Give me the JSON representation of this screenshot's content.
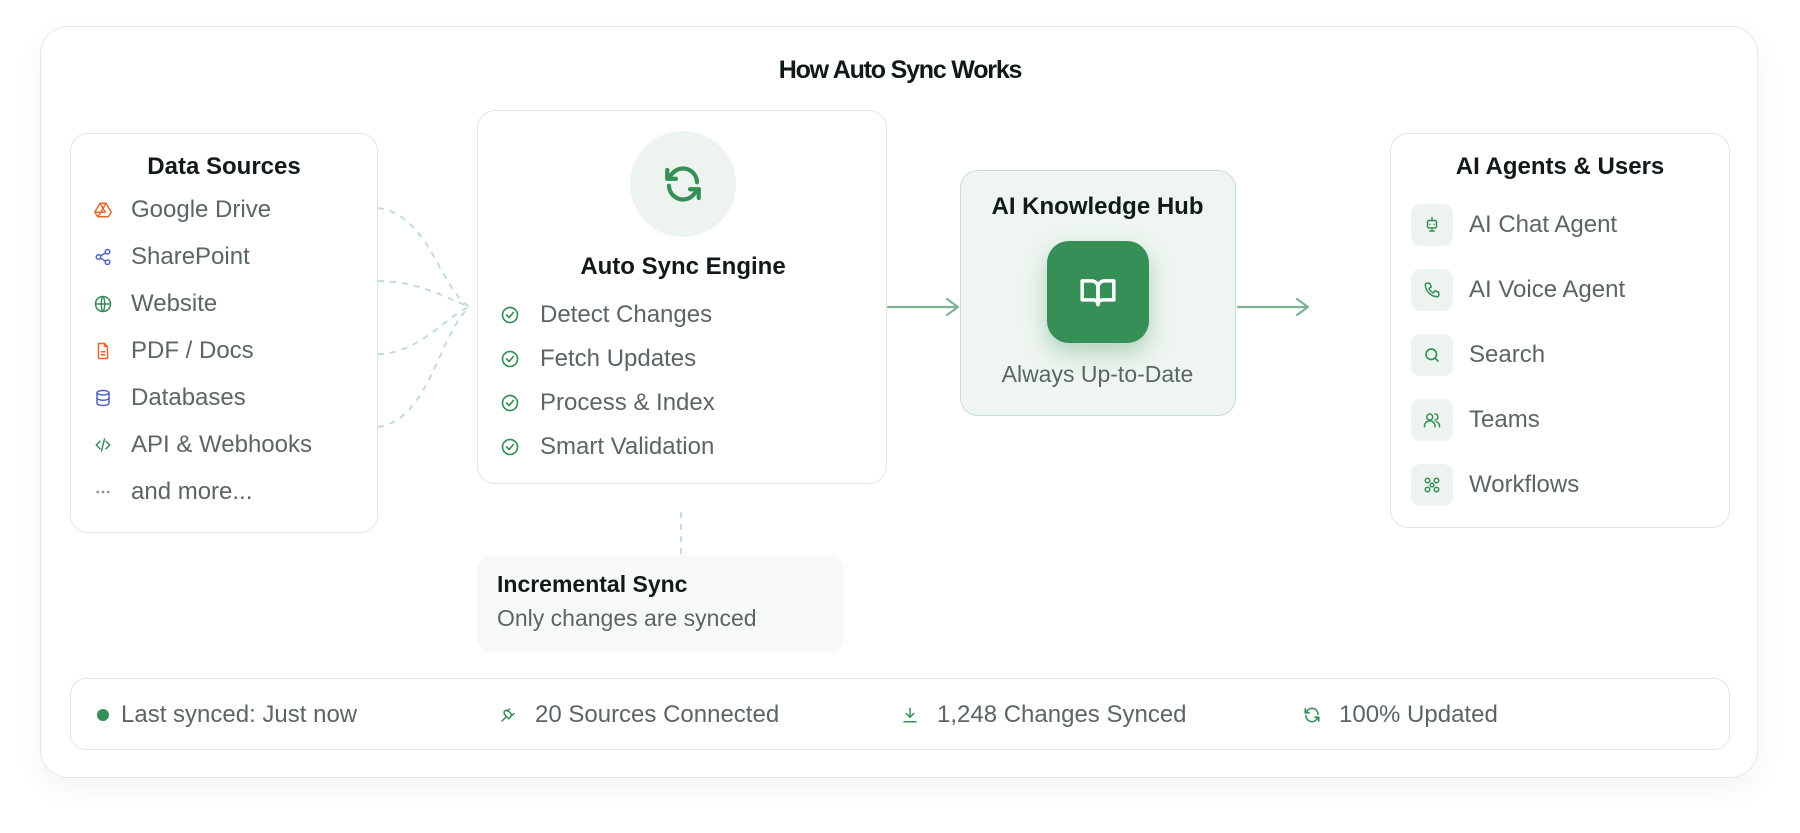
{
  "title": "How Auto Sync Works",
  "colors": {
    "accent": "#368f57",
    "accent_light": "#edf4ef",
    "text": "#5b6661",
    "heading": "#111a15"
  },
  "sources": {
    "title": "Data Sources",
    "items": [
      {
        "label": "Google Drive",
        "icon": "google-drive-icon",
        "color": "#e8692c"
      },
      {
        "label": "SharePoint",
        "icon": "share-icon",
        "color": "#4d62c9"
      },
      {
        "label": "Website",
        "icon": "globe-icon",
        "color": "#3b8a5c"
      },
      {
        "label": "PDF / Docs",
        "icon": "file-icon",
        "color": "#e8692c"
      },
      {
        "label": "Databases",
        "icon": "database-icon",
        "color": "#4d62c9"
      },
      {
        "label": "API & Webhooks",
        "icon": "code-icon",
        "color": "#3b8a5c"
      },
      {
        "label": "and more...",
        "icon": "more-icon",
        "color": "#8a928e"
      }
    ]
  },
  "engine": {
    "title": "Auto Sync Engine",
    "icon": "refresh-icon",
    "steps": [
      "Detect Changes",
      "Fetch Updates",
      "Process & Index",
      "Smart Validation"
    ]
  },
  "incremental": {
    "title": "Incremental Sync",
    "subtitle": "Only changes are synced"
  },
  "hub": {
    "title": "AI Knowledge Hub",
    "subtitle": "Always Up-to-Date",
    "icon": "book-icon"
  },
  "agents": {
    "title": "AI Agents & Users",
    "items": [
      {
        "label": "AI Chat Agent",
        "icon": "robot-icon"
      },
      {
        "label": "AI Voice Agent",
        "icon": "phone-icon"
      },
      {
        "label": "Search",
        "icon": "search-icon"
      },
      {
        "label": "Teams",
        "icon": "users-icon"
      },
      {
        "label": "Workflows",
        "icon": "workflow-icon"
      }
    ]
  },
  "status": {
    "last_synced": "Last synced: Just now",
    "sources_connected": "20 Sources Connected",
    "changes_synced": "1,248 Changes Synced",
    "updated": "100% Updated"
  }
}
